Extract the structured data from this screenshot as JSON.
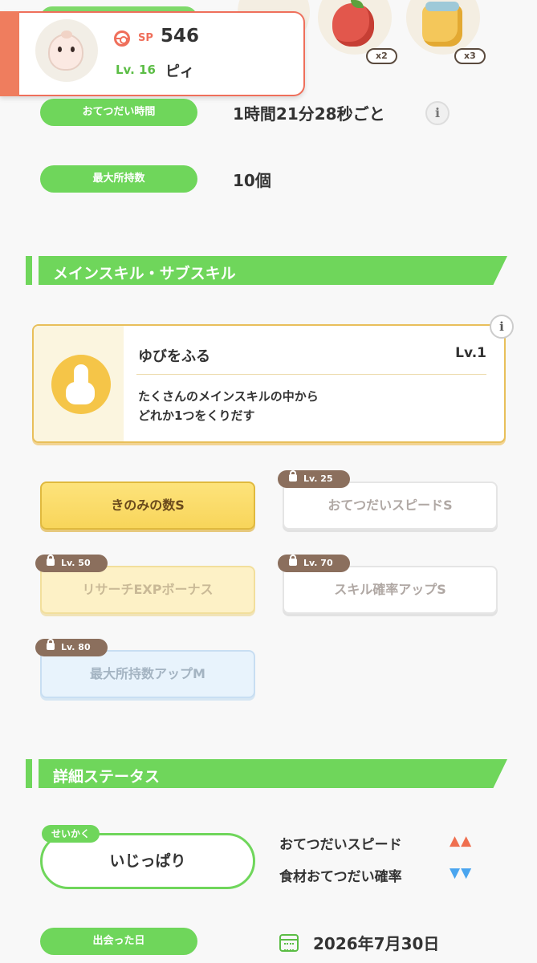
{
  "header": {
    "sp_label": "SP",
    "sp_value": "546",
    "level": "Lv. 16",
    "pokemon_name": "ピィ",
    "items": [
      {
        "name": "apple",
        "quantity": "x2"
      },
      {
        "name": "honey",
        "quantity": "x3"
      }
    ]
  },
  "info": {
    "help_time_label": "おてつだい時間",
    "help_time_value": "1時間21分28秒ごと",
    "max_carry_label": "最大所持数",
    "max_carry_value": "10個"
  },
  "sections": {
    "skills_title": "メインスキル・サブスキル",
    "details_title": "詳細ステータス"
  },
  "main_skill": {
    "name": "ゆびをふる",
    "level": "Lv.1",
    "description_line1": "たくさんのメインスキルの中から",
    "description_line2": "どれか1つをくりだす"
  },
  "sub_skills": [
    {
      "label": "きのみの数S",
      "unlock_level": "",
      "locked": false
    },
    {
      "label": "おてつだいスピードS",
      "unlock_level": "Lv. 25",
      "locked": true
    },
    {
      "label": "リサーチEXPボーナス",
      "unlock_level": "Lv. 50",
      "locked": true
    },
    {
      "label": "スキル確率アップS",
      "unlock_level": "Lv. 70",
      "locked": true
    },
    {
      "label": "最大所持数アップM",
      "unlock_level": "Lv. 80",
      "locked": true
    }
  ],
  "nature": {
    "tag": "せいかく",
    "value": "いじっぱり",
    "up_stat": "おてつだいスピード",
    "down_stat": "食材おてつだい確率"
  },
  "met": {
    "label": "出会った日",
    "date": "2026年7月30日"
  },
  "colors": {
    "accent_green": "#6fd65b",
    "coral": "#ef6f5b",
    "gold": "#f8d55a",
    "up_arrow": "#ef6f4f",
    "down_arrow": "#4aa5ef"
  }
}
